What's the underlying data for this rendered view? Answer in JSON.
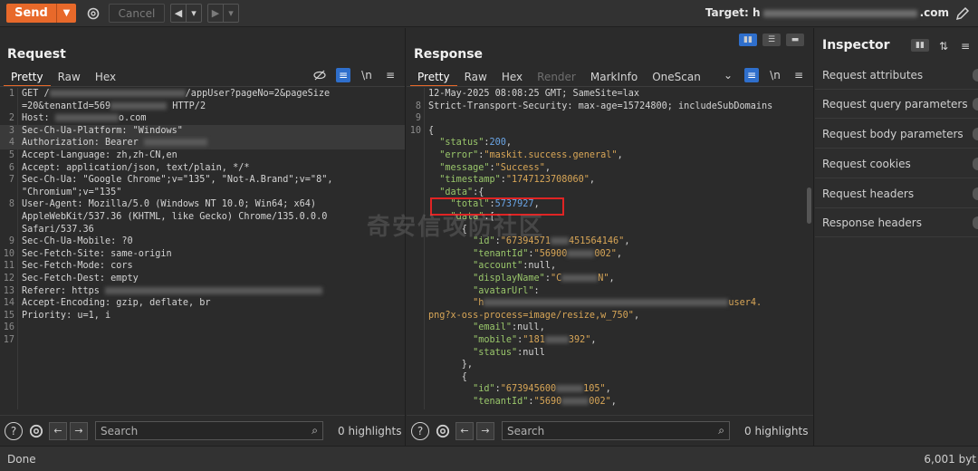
{
  "toolbar": {
    "send_label": "Send",
    "cancel_label": "Cancel",
    "target_label": "Target:",
    "target_prefix": "h",
    "target_suffix": ".com"
  },
  "request": {
    "title": "Request",
    "tabs": [
      "Pretty",
      "Raw",
      "Hex"
    ],
    "lines": [
      {
        "n": "1",
        "t": "GET /"
      },
      {
        "n": "",
        "t": "=20&tenantId=569"
      },
      {
        "n": "2",
        "t": "Host: "
      },
      {
        "n": "3",
        "t": "Sec-Ch-Ua-Platform: \"Windows\""
      },
      {
        "n": "4",
        "t": "Authorization: Bearer "
      },
      {
        "n": "5",
        "t": "Accept-Language: zh,zh-CN,en"
      },
      {
        "n": "6",
        "t": "Accept: application/json, text/plain, */*"
      },
      {
        "n": "7",
        "t": "Sec-Ch-Ua: \"Google Chrome\";v=\"135\", \"Not-A.Brand\";v=\"8\","
      },
      {
        "n": "",
        "t": "\"Chromium\";v=\"135\""
      },
      {
        "n": "8",
        "t": "User-Agent: Mozilla/5.0 (Windows NT 10.0; Win64; x64)"
      },
      {
        "n": "",
        "t": "AppleWebKit/537.36 (KHTML, like Gecko) Chrome/135.0.0.0"
      },
      {
        "n": "",
        "t": "Safari/537.36"
      },
      {
        "n": "9",
        "t": "Sec-Ch-Ua-Mobile: ?0"
      },
      {
        "n": "10",
        "t": "Sec-Fetch-Site: same-origin"
      },
      {
        "n": "11",
        "t": "Sec-Fetch-Mode: cors"
      },
      {
        "n": "12",
        "t": "Sec-Fetch-Dest: empty"
      },
      {
        "n": "13",
        "t": "Referer: https "
      },
      {
        "n": "14",
        "t": "Accept-Encoding: gzip, deflate, br"
      },
      {
        "n": "15",
        "t": "Priority: u=1, i"
      },
      {
        "n": "16",
        "t": ""
      },
      {
        "n": "17",
        "t": ""
      }
    ],
    "line1_tail": "/appUser?pageNo=2&pageSize",
    "line1b_tail": " HTTP/2",
    "host_tail": "o.com"
  },
  "response": {
    "title": "Response",
    "tabs": [
      "Pretty",
      "Raw",
      "Hex",
      "Render",
      "MarkInfo",
      "OneScan"
    ]
  },
  "inspector": {
    "title": "Inspector",
    "rows": [
      "Request attributes",
      "Request query parameters",
      "Request body parameters",
      "Request cookies",
      "Request headers",
      "Response headers"
    ]
  },
  "search": {
    "placeholder": "Search",
    "highlights": "0 highlights"
  },
  "status": {
    "text": "Done",
    "bytes": "6,001 byt"
  },
  "watermark": "奇安信攻防社区"
}
